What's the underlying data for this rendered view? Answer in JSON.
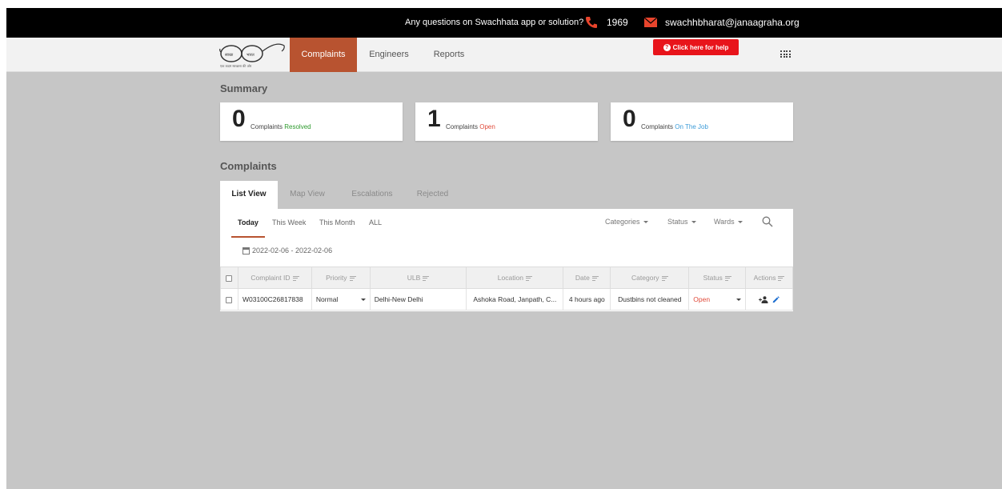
{
  "topbar": {
    "question": "Any questions on Swachhata app or solution?",
    "phone": "1969",
    "email": "swachhbharat@janaagraha.org",
    "phone_icon": "phone-icon",
    "mail_icon": "mail-icon",
    "color": "#000000"
  },
  "nav": {
    "logo_text_left": "स्वच्छ",
    "logo_text_right": "भारत",
    "logo_tagline": "एक कदम स्वच्छता की ओर",
    "tabs": [
      {
        "label": "Complaints",
        "active": true
      },
      {
        "label": "Engineers"
      },
      {
        "label": "Reports"
      }
    ],
    "active_color": "#b85330",
    "help_label": "Click here for help",
    "help_color": "#e8141b",
    "apps_icon": "apps-grid-icon"
  },
  "summary": {
    "title": "Summary",
    "cards": [
      {
        "count": "0",
        "label": "Complaints",
        "status": "Resolved",
        "status_color": "#2e9a2e"
      },
      {
        "count": "1",
        "label": "Complaints",
        "status": "Open",
        "status_color": "#e04a3a"
      },
      {
        "count": "0",
        "label": "Complaints",
        "status": "On The Job",
        "status_color": "#3b9bd8"
      }
    ]
  },
  "complaints": {
    "title": "Complaints",
    "view_tabs": [
      "List View",
      "Map View",
      "Escalations",
      "Rejected"
    ],
    "periods": [
      "Today",
      "This Week",
      "This Month",
      "ALL"
    ],
    "filters": [
      "Categories",
      "Status",
      "Wards"
    ],
    "date_range": "2022-02-06 - 2022-02-06",
    "columns": [
      "Complaint ID",
      "Priority",
      "ULB",
      "Location",
      "Date",
      "Category",
      "Status",
      "Actions"
    ],
    "rows": [
      {
        "id": "W03100C26817838",
        "priority": "Normal",
        "ulb": "Delhi-New Delhi",
        "location": "Ashoka Road, Janpath, C...",
        "date": "4 hours ago",
        "category": "Dustbins not cleaned",
        "status": "Open"
      }
    ]
  }
}
